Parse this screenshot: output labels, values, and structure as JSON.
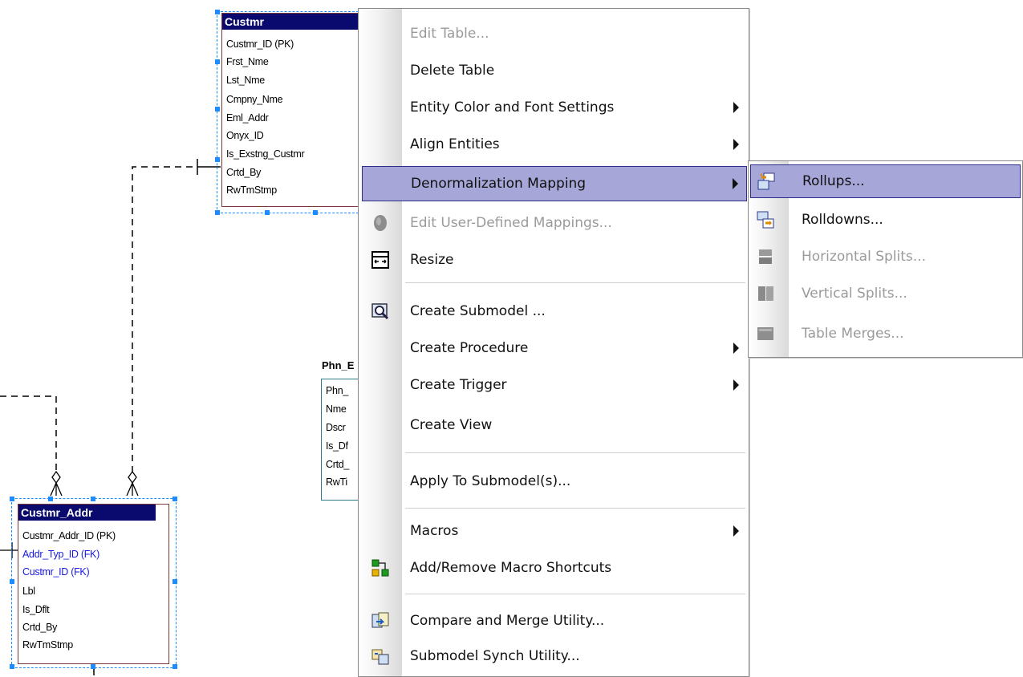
{
  "entities": {
    "customer": {
      "title": "Custmr",
      "attributes": [
        "Custmr_ID (PK)",
        "Frst_Nme",
        "Lst_Nme",
        "Cmpny_Nme",
        "Eml_Addr",
        "Onyx_ID",
        "Is_Exstng_Custmr",
        "Crtd_By",
        "RwTmStmp"
      ]
    },
    "customer_addr": {
      "title": "Custmr_Addr",
      "attributes": [
        {
          "text": "Custmr_Addr_ID (PK)",
          "fk": false
        },
        {
          "text": "Addr_Typ_ID (FK)",
          "fk": true
        },
        {
          "text": "Custmr_ID (FK)",
          "fk": true
        },
        {
          "text": "Lbl",
          "fk": false
        },
        {
          "text": "Is_Dflt",
          "fk": false
        },
        {
          "text": "Crtd_By",
          "fk": false
        },
        {
          "text": "RwTmStmp",
          "fk": false
        }
      ]
    },
    "phone": {
      "title": "Phn_E",
      "attributes": [
        "Phn_",
        "Nme",
        "Dscr",
        "Is_Df",
        "Crtd_",
        "RwTi"
      ]
    }
  },
  "context_menu": {
    "items": [
      {
        "label": "Edit Table...",
        "disabled": true,
        "submenu": false,
        "icon": null
      },
      {
        "label": "Delete Table",
        "disabled": false,
        "submenu": false,
        "icon": null
      },
      {
        "label": "Entity Color and Font Settings",
        "disabled": false,
        "submenu": true,
        "icon": null
      },
      {
        "label": "Align Entities",
        "disabled": false,
        "submenu": true,
        "icon": null
      },
      {
        "label": "Denormalization Mapping",
        "disabled": false,
        "submenu": true,
        "icon": null,
        "highlighted": true
      },
      {
        "label": "Edit User-Defined Mappings...",
        "disabled": true,
        "submenu": false,
        "icon": "user-mapping-icon"
      },
      {
        "label": "Resize",
        "disabled": false,
        "submenu": false,
        "icon": "resize-icon"
      },
      {
        "label": "Create Submodel ...",
        "disabled": false,
        "submenu": false,
        "icon": "create-submodel-icon"
      },
      {
        "label": "Create Procedure",
        "disabled": false,
        "submenu": true,
        "icon": null
      },
      {
        "label": "Create Trigger",
        "disabled": false,
        "submenu": true,
        "icon": null
      },
      {
        "label": "Create View",
        "disabled": false,
        "submenu": false,
        "icon": null
      },
      {
        "label": "Apply To Submodel(s)...",
        "disabled": false,
        "submenu": false,
        "icon": null
      },
      {
        "label": "Macros",
        "disabled": false,
        "submenu": true,
        "icon": null
      },
      {
        "label": "Add/Remove Macro Shortcuts",
        "disabled": false,
        "submenu": false,
        "icon": "macro-shortcuts-icon"
      },
      {
        "label": "Compare and Merge Utility...",
        "disabled": false,
        "submenu": false,
        "icon": "compare-merge-icon"
      },
      {
        "label": "Submodel Synch Utility...",
        "disabled": false,
        "submenu": false,
        "icon": "submodel-synch-icon"
      }
    ]
  },
  "submenu": {
    "items": [
      {
        "label": "Rollups...",
        "disabled": false,
        "highlighted": true,
        "icon": "rollups-icon"
      },
      {
        "label": "Rolldowns...",
        "disabled": false,
        "icon": "rolldowns-icon"
      },
      {
        "label": "Horizontal Splits...",
        "disabled": true,
        "icon": "horizontal-splits-icon"
      },
      {
        "label": "Vertical Splits...",
        "disabled": true,
        "icon": "vertical-splits-icon"
      },
      {
        "label": "Table Merges...",
        "disabled": true,
        "icon": "table-merges-icon"
      }
    ]
  },
  "colors": {
    "entity_header": "#0a0a6e",
    "fk_text": "#1818e6",
    "menu_highlight": "#a6a6d8",
    "selection": "#1e8bff"
  }
}
